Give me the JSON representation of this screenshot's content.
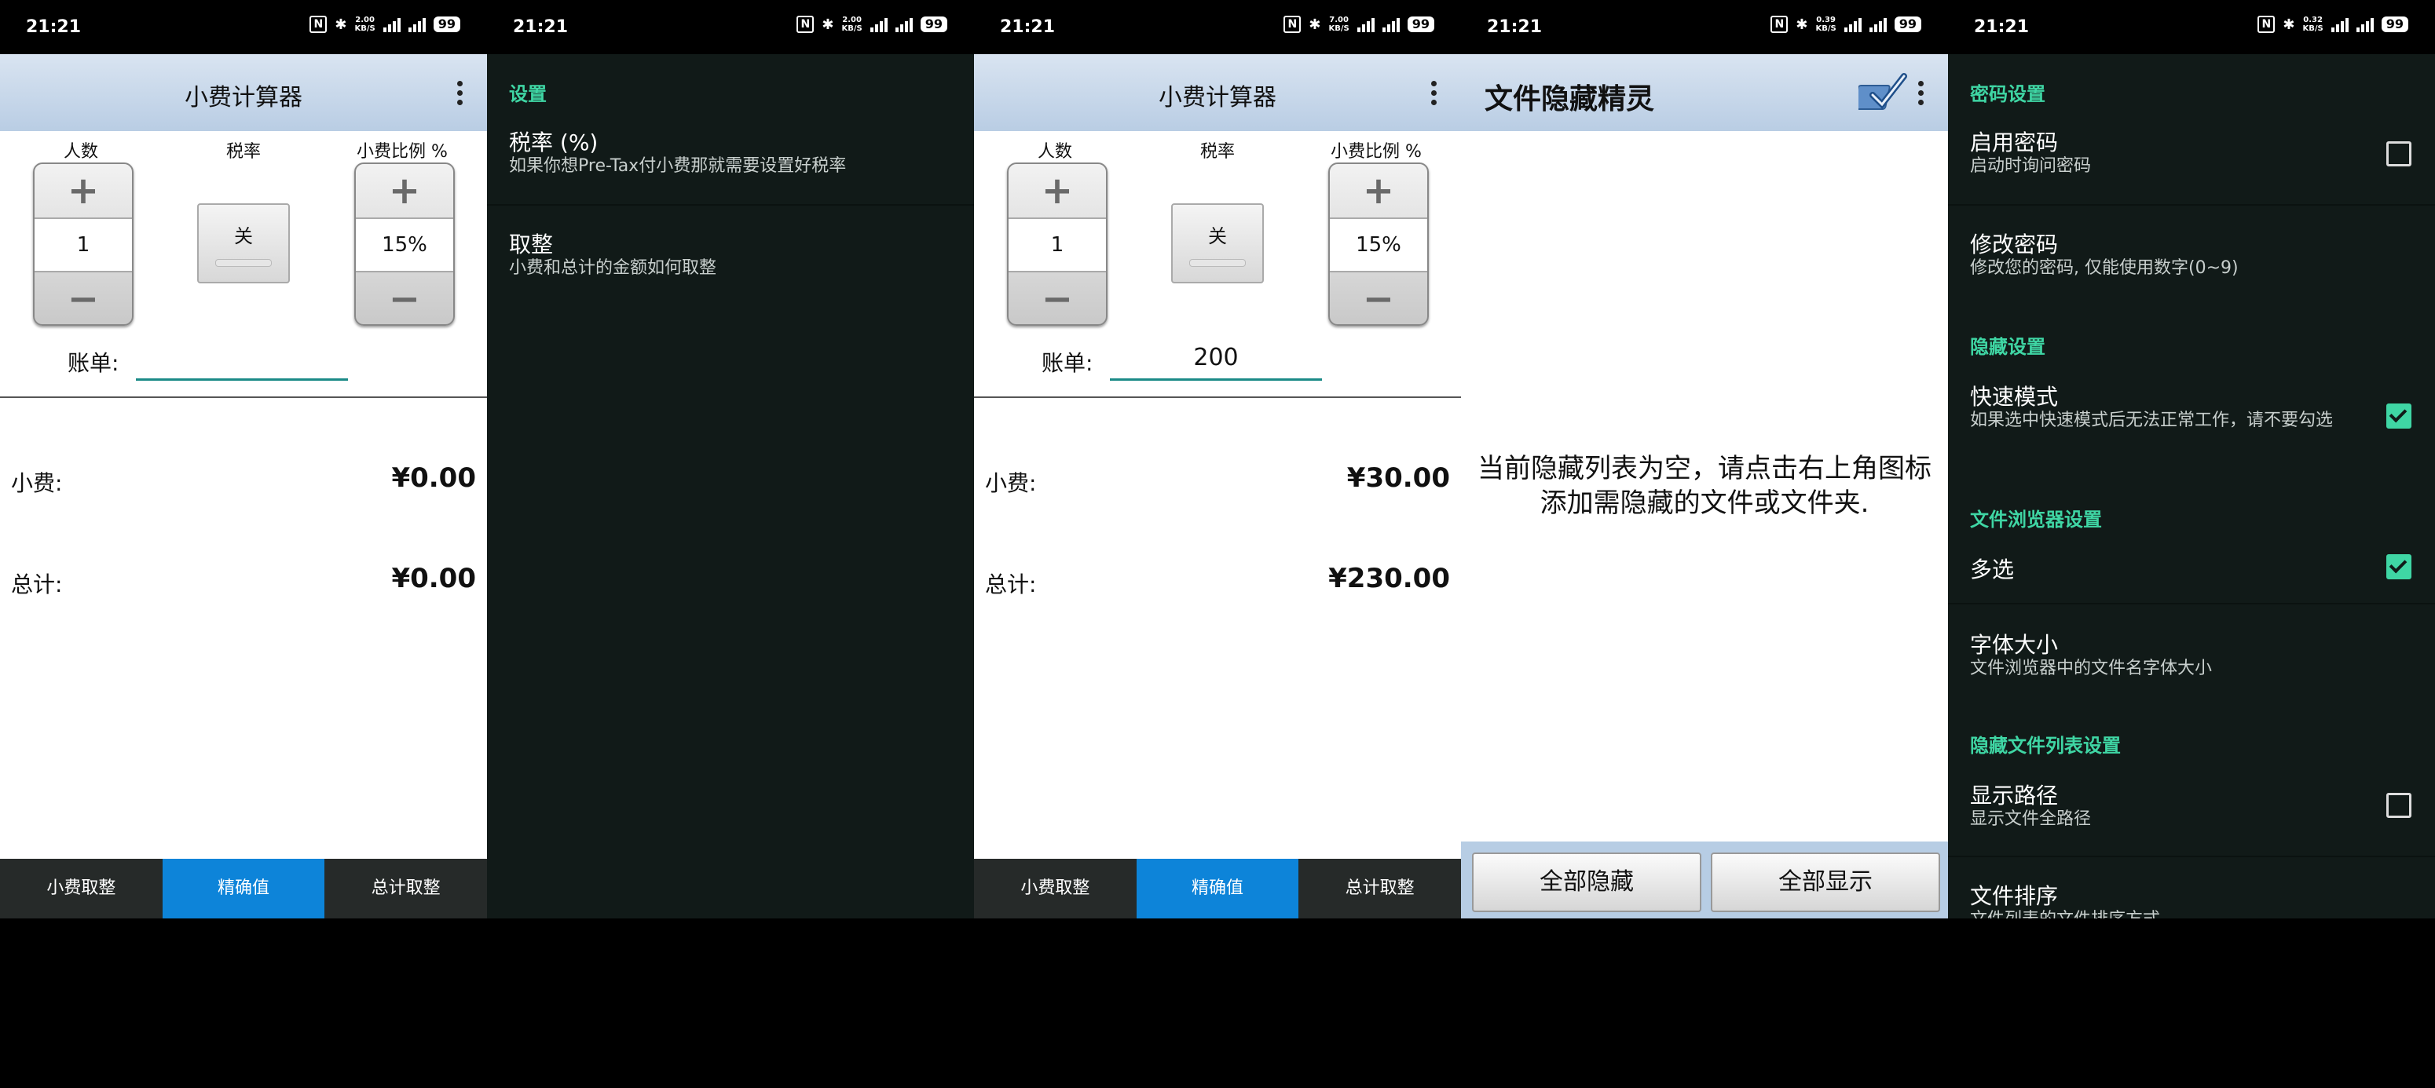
{
  "status_bars": [
    {
      "time": "21:21",
      "speed": "2.00\nKB/S",
      "battery": "99"
    },
    {
      "time": "21:21",
      "speed": "2.00\nKB/S",
      "battery": "99"
    },
    {
      "time": "21:21",
      "speed": "7.00\nKB/S",
      "battery": "99"
    },
    {
      "time": "21:21",
      "speed": "0.39\nKB/S",
      "battery": "99"
    },
    {
      "time": "21:21",
      "speed": "0.32\nKB/S",
      "battery": "99"
    }
  ],
  "tip1": {
    "title": "小费计算器",
    "col_people": "人数",
    "col_tax": "税率",
    "col_pct": "小费比例 %",
    "people": "1",
    "tax_toggle": "关",
    "pct": "15%",
    "bill_label": "账单:",
    "bill_value": "",
    "tip_label": "小费:",
    "tip_value": "¥0.00",
    "total_label": "总计:",
    "total_value": "¥0.00",
    "tabs": [
      "小费取整",
      "精确值",
      "总计取整"
    ]
  },
  "settings1": {
    "section": "设置",
    "items": [
      {
        "title": "税率 (%)",
        "subtitle": "如果你想Pre-Tax付小费那就需要设置好税率"
      },
      {
        "title": "取整",
        "subtitle": "小费和总计的金额如何取整"
      }
    ]
  },
  "tip2": {
    "title": "小费计算器",
    "col_people": "人数",
    "col_tax": "税率",
    "col_pct": "小费比例 %",
    "people": "1",
    "tax_toggle": "关",
    "pct": "15%",
    "bill_label": "账单:",
    "bill_value": "200",
    "tip_label": "小费:",
    "tip_value": "¥30.00",
    "total_label": "总计:",
    "total_value": "¥230.00",
    "tabs": [
      "小费取整",
      "精确值",
      "总计取整"
    ]
  },
  "hider": {
    "title": "文件隐藏精灵",
    "empty_line1": "当前隐藏列表为空，请点击右上角图标",
    "empty_line2": "添加需隐藏的文件或文件夹.",
    "hide_all": "全部隐藏",
    "show_all": "全部显示"
  },
  "settings2": {
    "sec_password": "密码设置",
    "enable_pw_title": "启用密码",
    "enable_pw_sub": "启动时询问密码",
    "enable_pw_checked": false,
    "change_pw_title": "修改密码",
    "change_pw_sub": "修改您的密码, 仅能使用数字(0~9)",
    "sec_hide": "隐藏设置",
    "fast_title": "快速模式",
    "fast_sub": "如果选中快速模式后无法正常工作，请不要勾选",
    "fast_checked": true,
    "sec_browser": "文件浏览器设置",
    "multi_title": "多选",
    "multi_checked": true,
    "font_title": "字体大小",
    "font_sub": "文件浏览器中的文件名字体大小",
    "sec_list": "隐藏文件列表设置",
    "path_title": "显示路径",
    "path_sub": "显示文件全路径",
    "path_checked": false,
    "sort_title": "文件排序",
    "sort_sub": "文件列表的文件排序方式"
  }
}
